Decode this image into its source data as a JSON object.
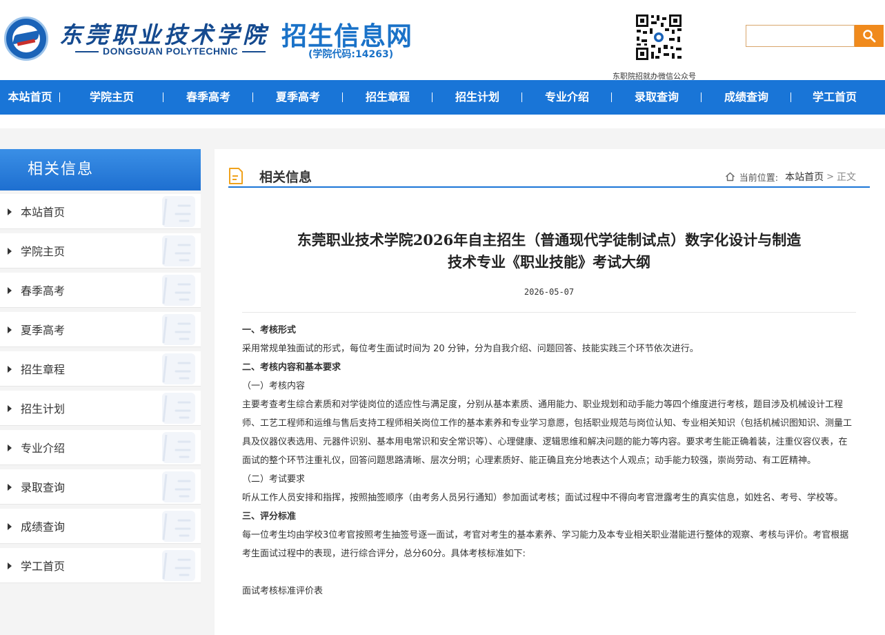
{
  "header": {
    "school_cn": "东莞职业技术学院",
    "school_en": "DONGGUAN POLYTECHNIC",
    "dot": "·",
    "site_title": "招生信息网",
    "site_code": "(学院代码:14263)",
    "qr_caption": "东职院招就办微信公众号",
    "search": {
      "value": "",
      "placeholder": ""
    }
  },
  "nav": {
    "items": [
      "本站首页",
      "学院主页",
      "春季高考",
      "夏季高考",
      "招生章程",
      "招生计划",
      "专业介绍",
      "录取查询",
      "成绩查询",
      "学工首页"
    ]
  },
  "sidebar": {
    "title": "相关信息",
    "items": [
      "本站首页",
      "学院主页",
      "春季高考",
      "夏季高考",
      "招生章程",
      "招生计划",
      "专业介绍",
      "录取查询",
      "成绩查询",
      "学工首页"
    ]
  },
  "content": {
    "section_title": "相关信息",
    "breadcrumb": {
      "label": "当前位置:",
      "home": "本站首页",
      "sep": ">",
      "current": "正文"
    },
    "article": {
      "title_line1": "东莞职业技术学院2026年自主招生（普通现代学徒制试点）数字化设计与制造",
      "title_line2": "技术专业《职业技能》考试大纲",
      "date": "2026-05-07",
      "paragraphs": [
        "一、考核形式",
        "采用常规单独面试的形式，每位考生面试时间为 20 分钟，分为自我介绍、问题回答、技能实践三个环节依次进行。",
        "二、考核内容和基本要求",
        "（一）考核内容",
        "主要考查考生综合素质和对学徒岗位的适应性与满足度，分别从基本素质、通用能力、职业规划和动手能力等四个维度进行考核，题目涉及机械设计工程师、工艺工程师和运维与售后支持工程师相关岗位工作的基本素养和专业学习意愿，包括职业规范与岗位认知、专业相关知识（包括机械识图知识、测量工具及仪器仪表选用、元器件识别、基本用电常识和安全常识等）、心理健康、逻辑思维和解决问题的能力等内容。要求考生能正确着装，注重仪容仪表，在面试的整个环节注重礼仪，回答问题思路清晰、层次分明；心理素质好、能正确且充分地表达个人观点；动手能力较强，崇尚劳动、有工匠精神。",
        "（二）考试要求",
        "听从工作人员安排和指挥，按照抽签顺序（由考务人员另行通知）参加面试考核；面试过程中不得向考官泄露考生的真实信息，如姓名、考号、学校等。",
        "三、评分标准",
        "每一位考生均由学校3位考官按照考生抽签号逐一面试，考官对考生的基本素养、学习能力及本专业相关职业潜能进行整体的观察、考核与评价。考官根据考生面试过程中的表现，进行综合评分，总分60分。具体考核标准如下:",
        "面试考核标准评价表"
      ]
    }
  },
  "colors": {
    "nav_bg": "#1975d7",
    "brand_blue": "#154a8f",
    "title_blue": "#1a72c8",
    "search_btn": "#f08a1c"
  },
  "icons": {
    "search": "search-icon",
    "home": "home-icon",
    "doc": "document-icon",
    "arrow": "triangle-right-icon"
  }
}
